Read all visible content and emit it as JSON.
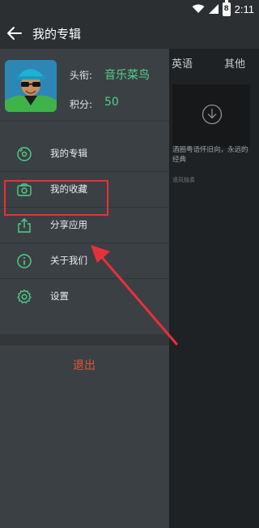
{
  "status_bar": {
    "time": "2:11",
    "battery_level": "8",
    "icons": [
      "wifi-icon",
      "signal-icon",
      "battery-icon"
    ]
  },
  "toolbar": {
    "title": "我的专辑",
    "back_icon": "back-arrow-icon"
  },
  "profile": {
    "title_label": "头衔:",
    "title_value": "音乐菜鸟",
    "points_label": "积分:",
    "points_value": "50"
  },
  "menu": {
    "items": [
      {
        "label": "我的专辑",
        "icon": "disc-icon"
      },
      {
        "label": "我的收藏",
        "icon": "camera-icon"
      },
      {
        "label": "分享应用",
        "icon": "share-icon"
      },
      {
        "label": "关于我们",
        "icon": "info-icon"
      },
      {
        "label": "设置",
        "icon": "gear-icon"
      }
    ],
    "logout_label": "退出"
  },
  "background": {
    "tabs": [
      "英语",
      "其他"
    ],
    "card_title": "酒圈粤语怀旧向，永远的经典",
    "card_subtitle": "语风独奏"
  },
  "colors": {
    "accent_green": "#4fd08a",
    "logout_red": "#e9532f",
    "annotation_red": "#e8303a"
  }
}
